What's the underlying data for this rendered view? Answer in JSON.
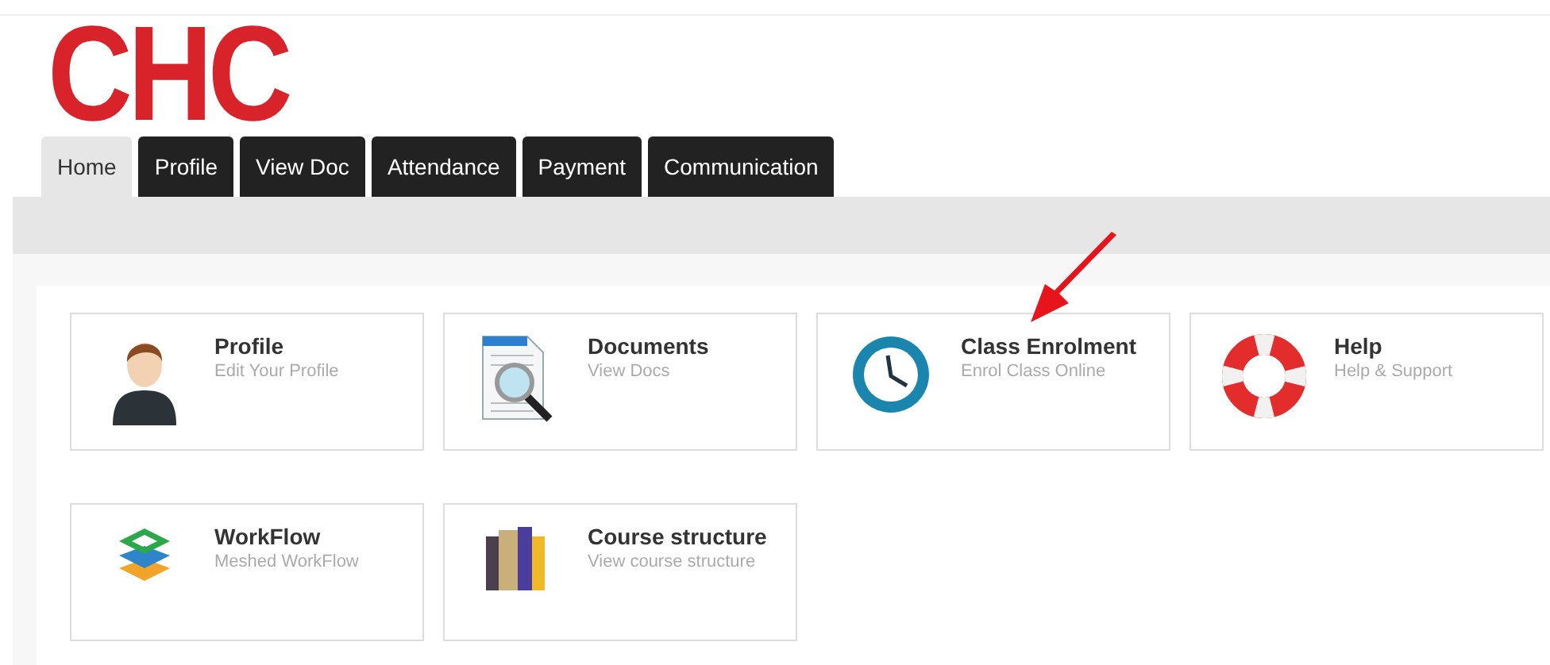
{
  "logo": "CHC",
  "tabs": [
    {
      "label": "Home",
      "selected": true
    },
    {
      "label": "Profile",
      "selected": false
    },
    {
      "label": "View Doc",
      "selected": false
    },
    {
      "label": "Attendance",
      "selected": false
    },
    {
      "label": "Payment",
      "selected": false
    },
    {
      "label": "Communication",
      "selected": false
    }
  ],
  "tiles": [
    [
      {
        "title": "Profile",
        "subtitle": "Edit Your Profile"
      },
      {
        "title": "Documents",
        "subtitle": "View Docs"
      },
      {
        "title": "Class Enrolment",
        "subtitle": "Enrol Class Online"
      },
      {
        "title": "Help",
        "subtitle": "Help & Support"
      }
    ],
    [
      {
        "title": "WorkFlow",
        "subtitle": "Meshed WorkFlow"
      },
      {
        "title": "Course structure",
        "subtitle": "View course structure"
      }
    ]
  ]
}
